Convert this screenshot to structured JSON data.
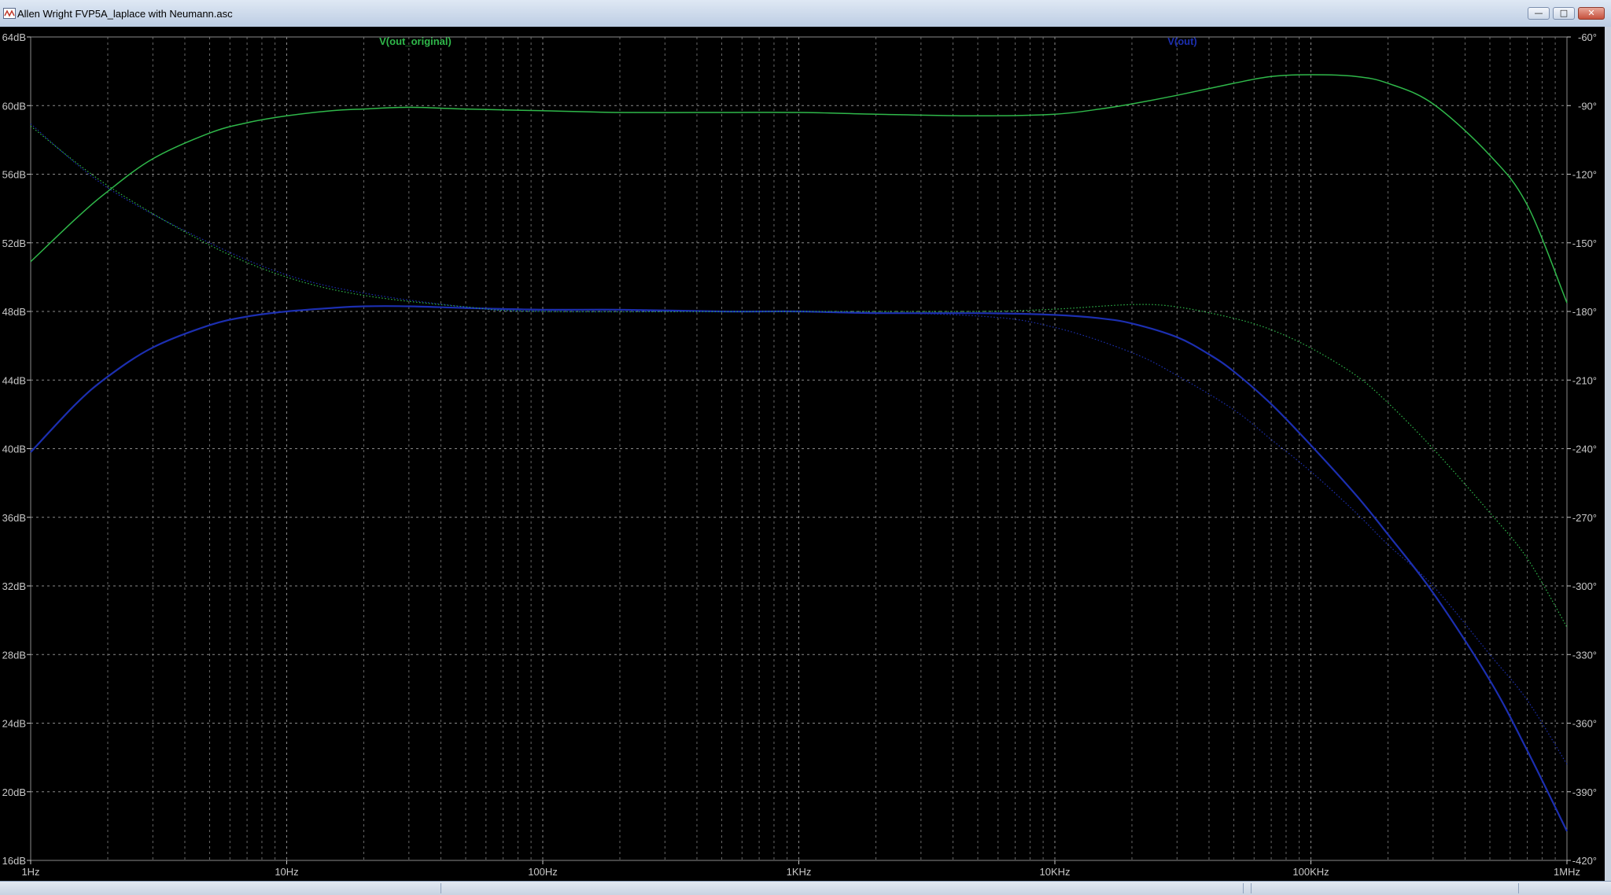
{
  "window": {
    "title": "Allen Wright FVP5A_laplace with Neumann.asc",
    "icon": "ltspice-waveform-icon",
    "buttons": {
      "minimize": "minimize-icon",
      "maximize": "maximize-icon",
      "close": "close-icon"
    }
  },
  "colors": {
    "background": "#000000",
    "grid": "#8a8a8a",
    "axis_text": "#c8c8c8",
    "v_out_original": "#2fb84a",
    "v_out": "#1c2fb0"
  },
  "chart_data": {
    "type": "line",
    "title": "",
    "x_scale": "log",
    "xlim": [
      1,
      1000000
    ],
    "x_ticks": [
      {
        "value": 1,
        "label": "1Hz"
      },
      {
        "value": 10,
        "label": "10Hz"
      },
      {
        "value": 100,
        "label": "100Hz"
      },
      {
        "value": 1000,
        "label": "1KHz"
      },
      {
        "value": 10000,
        "label": "10KHz"
      },
      {
        "value": 100000,
        "label": "100KHz"
      },
      {
        "value": 1000000,
        "label": "1MHz"
      }
    ],
    "ylim_left": [
      16,
      64
    ],
    "y_ticks_left": [
      {
        "value": 64,
        "label": "64dB"
      },
      {
        "value": 60,
        "label": "60dB"
      },
      {
        "value": 56,
        "label": "56dB"
      },
      {
        "value": 52,
        "label": "52dB"
      },
      {
        "value": 48,
        "label": "48dB"
      },
      {
        "value": 44,
        "label": "44dB"
      },
      {
        "value": 40,
        "label": "40dB"
      },
      {
        "value": 36,
        "label": "36dB"
      },
      {
        "value": 32,
        "label": "32dB"
      },
      {
        "value": 28,
        "label": "28dB"
      },
      {
        "value": 24,
        "label": "24dB"
      },
      {
        "value": 20,
        "label": "20dB"
      },
      {
        "value": 16,
        "label": "16dB"
      }
    ],
    "ylim_right": [
      -420,
      -60
    ],
    "y_ticks_right": [
      {
        "value": -60,
        "label": "-60°"
      },
      {
        "value": -90,
        "label": "-90°"
      },
      {
        "value": -120,
        "label": "-120°"
      },
      {
        "value": -150,
        "label": "-150°"
      },
      {
        "value": -180,
        "label": "-180°"
      },
      {
        "value": -210,
        "label": "-210°"
      },
      {
        "value": -240,
        "label": "-240°"
      },
      {
        "value": -270,
        "label": "-270°"
      },
      {
        "value": -300,
        "label": "-300°"
      },
      {
        "value": -330,
        "label": "-330°"
      },
      {
        "value": -360,
        "label": "-360°"
      },
      {
        "value": -390,
        "label": "-390°"
      },
      {
        "value": -420,
        "label": "-420°"
      }
    ],
    "grid": true,
    "legend": [
      {
        "name": "V(out_original)",
        "color": "#2fb84a"
      },
      {
        "name": "V(out)",
        "color": "#1c2fb0"
      }
    ],
    "series": [
      {
        "name": "V(out_original)",
        "kind": "magnitude",
        "axis": "left",
        "color": "#2fb84a",
        "x": [
          1,
          1.5,
          2,
          3,
          5,
          7,
          10,
          15,
          20,
          30,
          50,
          100,
          200,
          500,
          1000,
          2000,
          5000,
          10000,
          15000,
          20000,
          30000,
          50000,
          70000,
          100000,
          150000,
          200000,
          300000,
          500000,
          700000,
          1000000
        ],
        "y": [
          50.9,
          53.4,
          55.0,
          56.9,
          58.4,
          59.0,
          59.4,
          59.7,
          59.8,
          59.9,
          59.8,
          59.7,
          59.6,
          59.6,
          59.6,
          59.5,
          59.4,
          59.5,
          59.8,
          60.1,
          60.6,
          61.3,
          61.7,
          61.8,
          61.7,
          61.3,
          60.1,
          57.1,
          54.2,
          48.5
        ]
      },
      {
        "name": "V(out)",
        "kind": "magnitude",
        "axis": "left",
        "color": "#1c2fb0",
        "x": [
          1,
          1.5,
          2,
          3,
          5,
          7,
          10,
          15,
          20,
          30,
          50,
          100,
          200,
          500,
          1000,
          2000,
          5000,
          10000,
          15000,
          20000,
          30000,
          40000,
          50000,
          70000,
          100000,
          150000,
          200000,
          300000,
          500000,
          700000,
          1000000
        ],
        "y": [
          39.8,
          42.6,
          44.2,
          45.9,
          47.2,
          47.7,
          48.0,
          48.2,
          48.3,
          48.3,
          48.2,
          48.1,
          48.1,
          48.0,
          48.0,
          47.9,
          47.9,
          47.8,
          47.6,
          47.3,
          46.5,
          45.5,
          44.5,
          42.6,
          40.2,
          37.3,
          35.0,
          31.6,
          26.5,
          22.4,
          17.7
        ]
      },
      {
        "name": "V(out_original)",
        "kind": "phase",
        "axis": "right",
        "color": "#2fb84a",
        "x": [
          1,
          2,
          5,
          10,
          20,
          50,
          100,
          1000,
          5000,
          10000,
          20000,
          30000,
          50000,
          70000,
          100000,
          150000,
          200000,
          300000,
          500000,
          700000,
          1000000
        ],
        "y": [
          -99,
          -125,
          -151,
          -165,
          -173,
          -178,
          -180,
          -180,
          -180,
          -179,
          -177,
          -178,
          -183,
          -188,
          -196,
          -208,
          -220,
          -240,
          -268,
          -288,
          -318
        ]
      },
      {
        "name": "V(out)",
        "kind": "phase",
        "axis": "right",
        "color": "#1c2fb0",
        "x": [
          1,
          2,
          5,
          10,
          20,
          50,
          100,
          1000,
          5000,
          10000,
          20000,
          30000,
          50000,
          70000,
          100000,
          150000,
          200000,
          300000,
          500000,
          700000,
          1000000
        ],
        "y": [
          -98,
          -126,
          -150,
          -164,
          -172,
          -178,
          -180,
          -180,
          -182,
          -187,
          -198,
          -208,
          -223,
          -236,
          -250,
          -268,
          -282,
          -300,
          -330,
          -350,
          -378
        ]
      }
    ]
  }
}
